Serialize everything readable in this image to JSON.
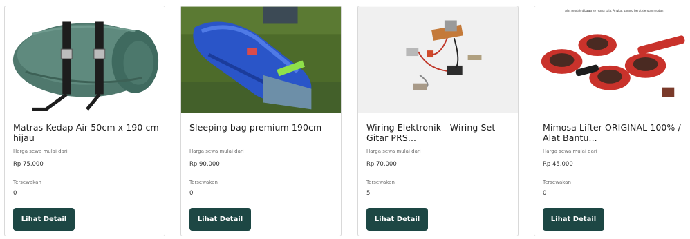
{
  "products": [
    {
      "title": "Matras Kedap Air 50cm x 190 cm hijau",
      "price_label": "Harga sewa mulai dari",
      "price": "Rp 75.000",
      "rented_label": "Tersewakan",
      "rented_count": "0",
      "button_label": "Lihat Detail",
      "image": "green-air-mattress-rolled"
    },
    {
      "title": "Sleeping bag premium 190cm",
      "price_label": "Harga sewa mulai dari",
      "price": "Rp 90.000",
      "rented_label": "Tersewakan",
      "rented_count": "0",
      "button_label": "Lihat Detail",
      "image": "blue-sleeping-bag-on-grass"
    },
    {
      "title": "Wiring Elektronik - Wiring Set Gitar PRS...",
      "price_label": "Harga sewa mulai dari",
      "price": "Rp 70.000",
      "rented_label": "Tersewakan",
      "rented_count": "5",
      "button_label": "Lihat Detail",
      "image": "guitar-wiring-set"
    },
    {
      "title": "Mimosa Lifter ORIGINAL 100% / Alat Bantu...",
      "price_label": "Harga sewa mulai dari",
      "price": "Rp 45.000",
      "rented_label": "Tersewakan",
      "rented_count": "0",
      "button_label": "Lihat Detail",
      "image": "red-furniture-lifter-set",
      "image_caption": "Alat mudah dibawa ke mana saja. Angkat barang berat dengan mudah."
    }
  ],
  "colors": {
    "button": "#1d4744",
    "border": "#d9d9d9"
  }
}
